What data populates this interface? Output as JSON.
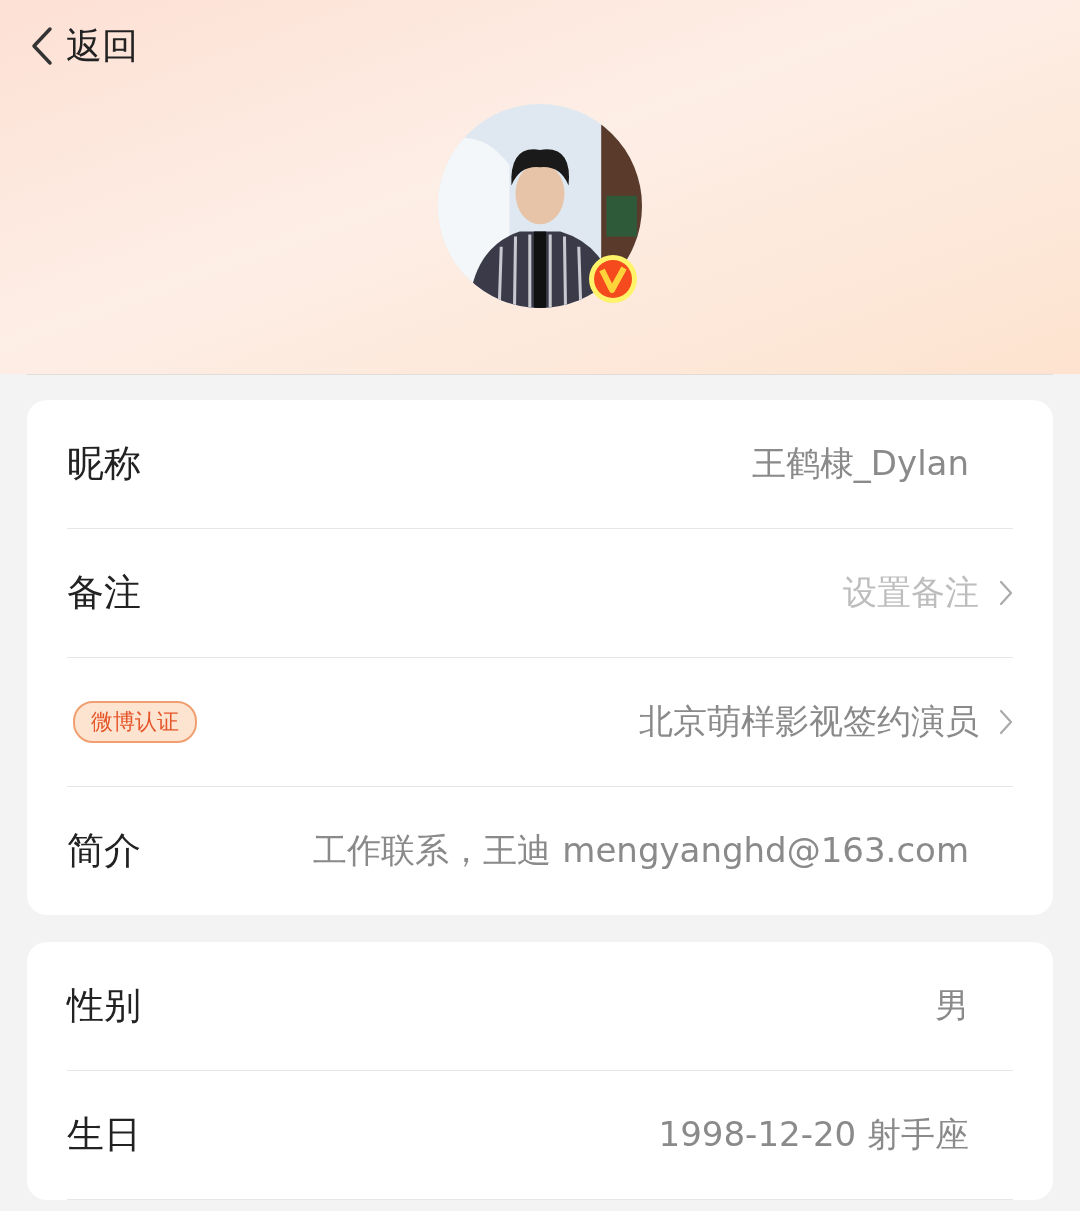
{
  "header": {
    "back_label": "返回"
  },
  "profile": {
    "verified": true
  },
  "cards": [
    {
      "rows": [
        {
          "kind": "text",
          "label": "昵称",
          "value": "王鹤棣_Dylan",
          "has_arrow": false
        },
        {
          "kind": "text",
          "label": "备注",
          "placeholder": "设置备注",
          "has_arrow": true
        },
        {
          "kind": "badge",
          "label": "微博认证",
          "value": "北京萌样影视签约演员",
          "has_arrow": true
        },
        {
          "kind": "text",
          "label": "简介",
          "value": "工作联系，王迪 mengyanghd@163.com",
          "has_arrow": false
        }
      ]
    },
    {
      "rows": [
        {
          "kind": "text",
          "label": "性别",
          "value": "男",
          "has_arrow": false
        },
        {
          "kind": "text",
          "label": "生日",
          "value": "1998-12-20 射手座",
          "has_arrow": false
        }
      ]
    }
  ]
}
